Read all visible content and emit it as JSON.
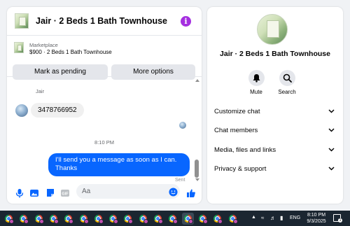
{
  "chat": {
    "title": "Jair · 2 Beds 1 Bath Townhouse",
    "listing": {
      "category": "Marketplace",
      "name": "$900 · 2 Beds 1 Bath Townhouse"
    },
    "buttons": {
      "mark_pending": "Mark as pending",
      "more_options": "More options"
    },
    "messages": {
      "sender_name": "Jair",
      "incoming_text": "3478766952",
      "time_separator": "8:10 PM",
      "outgoing_text": "I'll send you a message as soon as I can. Thanks",
      "status": "Sent"
    },
    "composer": {
      "placeholder": "Aa"
    }
  },
  "sidebar": {
    "title": "Jair · 2 Beds 1 Bath Townhouse",
    "actions": {
      "mute": "Mute",
      "search": "Search"
    },
    "rows": [
      {
        "label": "Customize chat"
      },
      {
        "label": "Chat members"
      },
      {
        "label": "Media, files and links"
      },
      {
        "label": "Privacy & support"
      }
    ]
  },
  "taskbar": {
    "app_icons": [
      "chrome-icon",
      "chrome-icon",
      "chrome-icon",
      "chrome-icon",
      "chrome-icon",
      "chrome-icon",
      "chrome-icon",
      "chrome-icon",
      "chrome-icon",
      "chrome-icon",
      "chrome-icon",
      "chrome-icon",
      "chrome-icon",
      "chrome-icon",
      "chrome-icon",
      "chrome-icon"
    ],
    "language": "ENG",
    "time": "8:10 PM",
    "date": "9/3/2025",
    "notification_count": "1"
  },
  "colors": {
    "accent": "#0866ff",
    "info": "#a52fe0",
    "taskbar": "#1b2631"
  }
}
